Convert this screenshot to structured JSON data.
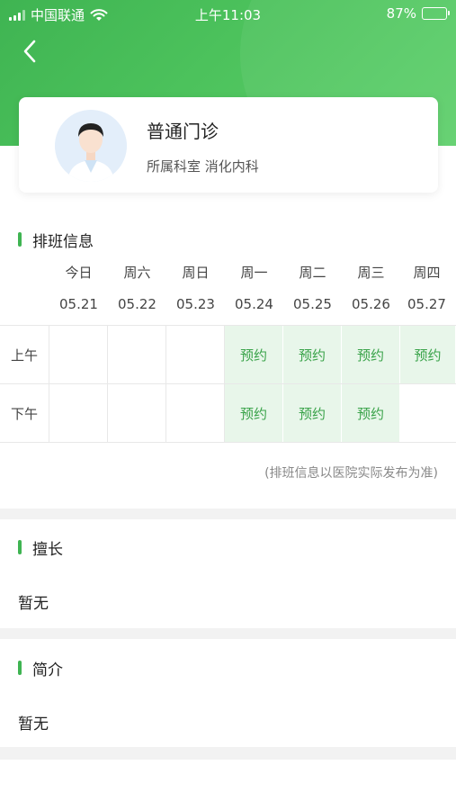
{
  "status_bar": {
    "carrier": "中国联通",
    "time": "上午11:03",
    "battery_percent": "87%",
    "battery_level": 0.87
  },
  "doctor": {
    "name": "普通门诊",
    "department_label": "所属科室 消化内科"
  },
  "schedule": {
    "title": "排班信息",
    "days": [
      {
        "name": "今日",
        "date": "05.21"
      },
      {
        "name": "周六",
        "date": "05.22"
      },
      {
        "name": "周日",
        "date": "05.23"
      },
      {
        "name": "周一",
        "date": "05.24"
      },
      {
        "name": "周二",
        "date": "05.25"
      },
      {
        "name": "周三",
        "date": "05.26"
      },
      {
        "name": "周四",
        "date": "05.27"
      }
    ],
    "rows": [
      {
        "label": "上午",
        "cells": [
          "",
          "",
          "",
          "预约",
          "预约",
          "预约",
          "预约"
        ]
      },
      {
        "label": "下午",
        "cells": [
          "",
          "",
          "",
          "预约",
          "预约",
          "预约",
          ""
        ]
      }
    ],
    "note": "(排班信息以医院实际发布为准)"
  },
  "specialty": {
    "title": "擅长",
    "text": "暂无"
  },
  "intro": {
    "title": "简介",
    "text": "暂无"
  },
  "colors": {
    "primary_green": "#3fb452",
    "available_bg": "#e8f6ea",
    "available_text": "#3aa34a"
  },
  "icons": {
    "back": "chevron-left-icon",
    "wifi": "wifi-icon",
    "signal": "signal-icon",
    "battery": "battery-icon"
  }
}
